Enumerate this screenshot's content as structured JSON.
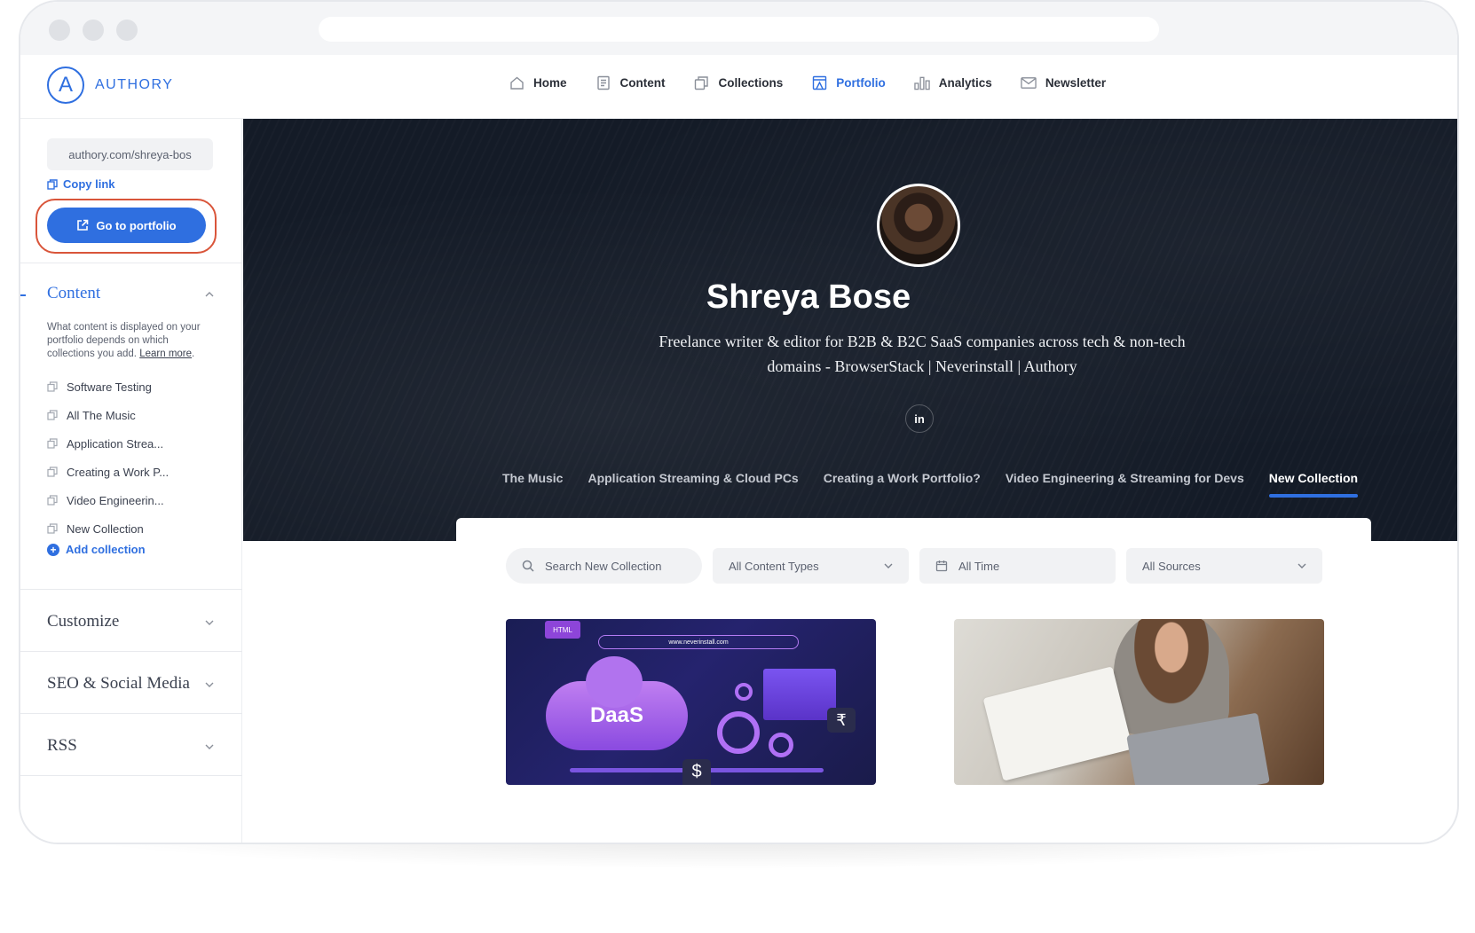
{
  "app": {
    "logo_letter": "A",
    "logo_text": "AUTHORY"
  },
  "nav": {
    "items": [
      {
        "label": "Home",
        "icon": "home-icon",
        "active": false
      },
      {
        "label": "Content",
        "icon": "content-icon",
        "active": false
      },
      {
        "label": "Collections",
        "icon": "collections-icon",
        "active": false
      },
      {
        "label": "Portfolio",
        "icon": "portfolio-icon",
        "active": true
      },
      {
        "label": "Analytics",
        "icon": "analytics-icon",
        "active": false
      },
      {
        "label": "Newsletter",
        "icon": "newsletter-icon",
        "active": false
      }
    ]
  },
  "sidebar": {
    "portfolio_url": "authory.com/shreya-bos",
    "copy_link": "Copy link",
    "go_to_portfolio": "Go to portfolio",
    "content_section": {
      "title": "Content",
      "description": "What content is displayed on your portfolio depends on which collections you add.",
      "learn_more": "Learn more",
      "collections": [
        "Software Testing",
        "All The Music",
        "Application Strea...",
        "Creating a Work P...",
        "Video Engineerin...",
        "New Collection"
      ],
      "add_collection": "Add collection"
    },
    "customize": "Customize",
    "seo": "SEO & Social Media",
    "rss": "RSS"
  },
  "hero": {
    "name": "Shreya Bose",
    "bio_line1": "Freelance writer & editor for B2B & B2C SaaS companies across tech & non-tech",
    "bio_line2": "domains - BrowserStack | Neverinstall | Authory",
    "linkedin": "in"
  },
  "tabs": [
    {
      "label": "The Music",
      "active": false
    },
    {
      "label": "Application Streaming & Cloud PCs",
      "active": false
    },
    {
      "label": "Creating a Work Portfolio?",
      "active": false
    },
    {
      "label": "Video Engineering & Streaming for Devs",
      "active": false
    },
    {
      "label": "New Collection",
      "active": true
    }
  ],
  "filters": {
    "search_placeholder": "Search New Collection",
    "content_types": "All Content Types",
    "time": "All Time",
    "sources": "All Sources"
  },
  "cards": {
    "card1": {
      "tag": "HTML",
      "url": "www.neverinstall.com",
      "cloud_text": "DaaS",
      "rupee": "₹",
      "dollar": "$"
    }
  },
  "colors": {
    "accent": "#2f6fe0",
    "hero_bg": "#141b27",
    "highlight_border": "#d9553a"
  }
}
